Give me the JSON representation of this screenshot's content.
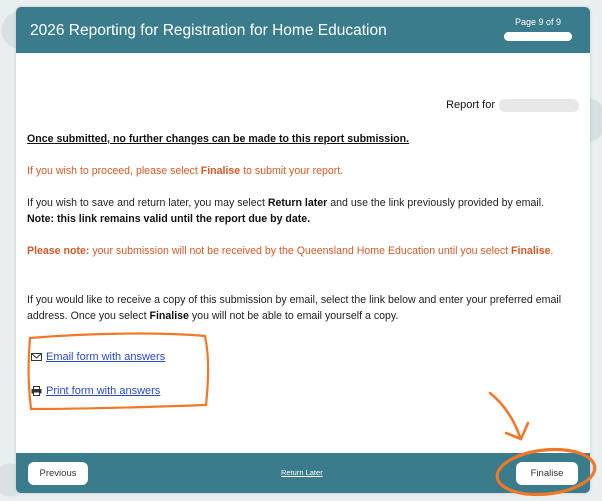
{
  "header": {
    "title": "2026 Reporting for Registration for Home Education",
    "page_indicator": "Page 9 of 9",
    "progress_fraction": 1.0
  },
  "report_for": {
    "label": "Report for"
  },
  "body": {
    "warning": "Once submitted, no further changes can be made to this report submission.",
    "proceed_pre": "If you wish to proceed, please select ",
    "proceed_bold": "Finalise",
    "proceed_post": " to submit your report.",
    "return_pre": "If you wish to save and return later, you may select ",
    "return_bold": "Return later",
    "return_post": " and use the link previously provided by email.",
    "note": "Note: this link remains valid until the report due by date.",
    "pn_label": "Please note:",
    "pn_text": " your submission will not be received by the Queensland Home Education until you select ",
    "pn_bold": "Finalise",
    "pn_end": ".",
    "copy_pre": "If you would like to receive a copy of this submission by email, select the link below and enter your preferred email address. Once you select ",
    "copy_bold": "Finalise",
    "copy_post": " you will not be able to email yourself a copy."
  },
  "links": {
    "email": "Email form with answers",
    "print": "Print form with answers"
  },
  "footer": {
    "previous": "Previous",
    "return_later": "Return Later",
    "finalise": "Finalise"
  },
  "colors": {
    "header_bg": "#3a7c8c",
    "orange_text": "#d35a2a",
    "annotation": "#f07828",
    "link": "#2a48c4"
  }
}
